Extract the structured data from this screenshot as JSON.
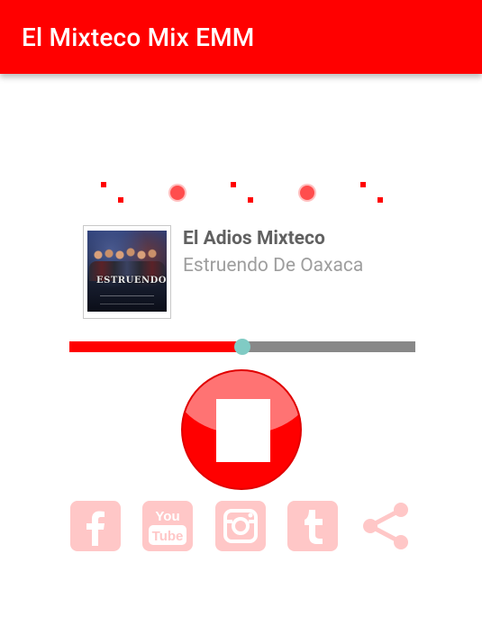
{
  "app_bar": {
    "title": "El Mixteco Mix EMM",
    "color": "#ff0000"
  },
  "now_playing": {
    "title": "El Adios Mixteco",
    "artist": "Estruendo De Oaxaca",
    "cover_icon": "album-cover-image",
    "cover_logo": "ESTRUENDO"
  },
  "slider": {
    "value_fraction": 0.5,
    "fill_color": "#ff0000",
    "track_color": "#888888",
    "thumb_color": "#80cbc4"
  },
  "stop_button": {
    "icon": "stop-icon"
  },
  "social": [
    {
      "name": "facebook",
      "icon": "facebook-icon"
    },
    {
      "name": "youtube",
      "icon": "youtube-icon",
      "label_top": "You",
      "label_bottom": "Tube"
    },
    {
      "name": "instagram",
      "icon": "instagram-icon"
    },
    {
      "name": "tumblr",
      "icon": "tumblr-icon"
    },
    {
      "name": "share",
      "icon": "share-icon"
    }
  ],
  "colors": {
    "accent": "#ff0000",
    "social_tint": "#ffc7c7",
    "title_text": "#616161",
    "artist_text": "#9e9e9e"
  }
}
